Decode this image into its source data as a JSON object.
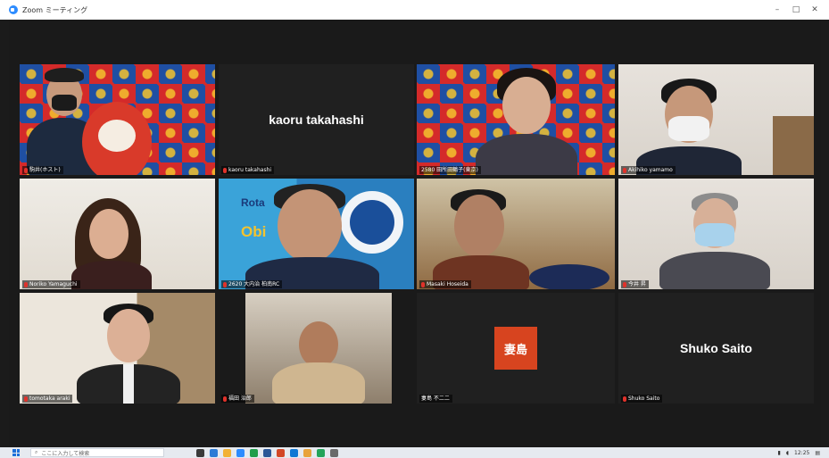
{
  "window": {
    "title": "Zoom ミーティング",
    "minimize": "–",
    "maximize": "□",
    "close": "✕"
  },
  "colors": {
    "active_speaker": "#a6e14a",
    "muted_mic": "#e0322b",
    "stage_bg": "#1a1a1a"
  },
  "participants": [
    {
      "label": "駒井(ホスト)",
      "muted": true,
      "video": true
    },
    {
      "label": "kaoru takahashi",
      "display_name": "kaoru takahashi",
      "muted": true,
      "video": false
    },
    {
      "label": "2580 田所田鶴子(東京)",
      "muted": false,
      "video": true,
      "active_speaker": true
    },
    {
      "label": "Akihiko yamamo",
      "muted": true,
      "video": true
    },
    {
      "label": "Noriko Yamaguchi",
      "muted": true,
      "video": true
    },
    {
      "label": "2620 大内治 柏南RC",
      "muted": true,
      "video": true
    },
    {
      "label": "Masaki Hoseida",
      "muted": true,
      "video": true
    },
    {
      "label": "今井 昇",
      "muted": true,
      "video": true
    },
    {
      "label": "tomotaka araki",
      "muted": true,
      "video": true
    },
    {
      "label": "福田 治郎",
      "muted": true,
      "video": true
    },
    {
      "label": "妻島 不二二",
      "avatar_text": "妻島",
      "muted": false,
      "video": false
    },
    {
      "label": "Shuko Saito",
      "display_name": "Shuko Saito",
      "muted": true,
      "video": false
    }
  ],
  "tiles_text": {
    "district_rota": "Rota",
    "district_obi": "Obi"
  },
  "taskbar": {
    "search_placeholder": "ここに入力して検索",
    "time": "12:25"
  }
}
